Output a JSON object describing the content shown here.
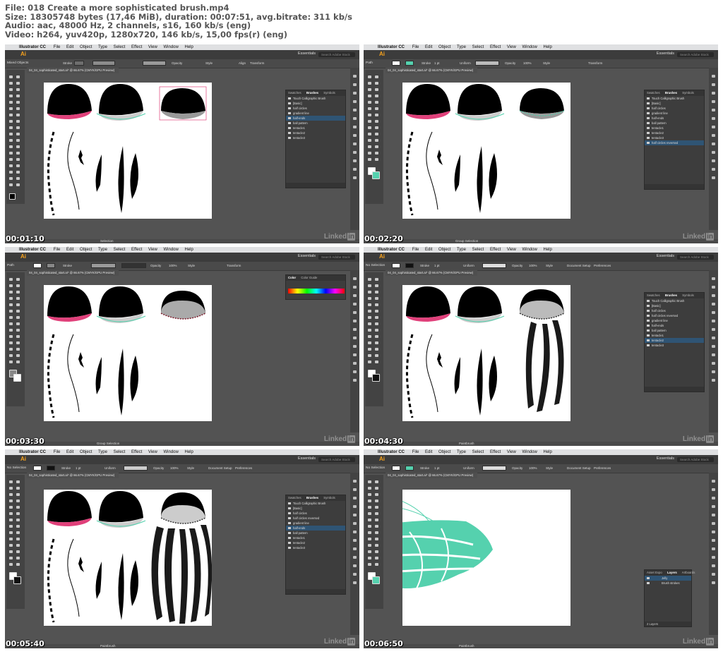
{
  "header": {
    "line1": "File: 018 Create a more sophisticated brush.mp4",
    "line2": "Size: 18305748 bytes (17,46 MiB), duration: 00:07:51, avg.bitrate: 311 kb/s",
    "line3": "Audio: aac, 48000 Hz, 2 channels, s16, 160 kb/s (eng)",
    "line4": "Video: h264, yuv420p, 1280x720, 146 kb/s, 15,00 fps(r) (eng)"
  },
  "ui": {
    "app": "Illustrator CC",
    "menu": [
      "File",
      "Edit",
      "Object",
      "Type",
      "Select",
      "Effect",
      "View",
      "Window",
      "Help"
    ],
    "ai_logo": "Ai",
    "workspace": "Essentials",
    "search_placeholder": "Search Adobe Stock",
    "doc_tab": "04_04_sophisticated_start.ai* @ 66.67% (CMYK/GPU Preview)",
    "watermark_text": "Linked",
    "watermark_in": "in",
    "colors": {
      "accent_teal": "#55d1ae",
      "selection_red": "#e0407a",
      "panel_highlight": "#2f5474"
    }
  },
  "frames": [
    {
      "time": "00:01:10",
      "selection": "Mixed Objects",
      "stroke_label": "Stroke",
      "opacity_label": "Opacity",
      "style_label": "Style",
      "align_label": "Align",
      "transform_label": "Transform",
      "status": "Selection",
      "panel": {
        "tabs": [
          "Swatches",
          "Brushes",
          "Symbols"
        ],
        "rows": [
          "Touch Calligraphic Brush",
          "[Basic]",
          "half circles",
          "gradient line",
          "half-ends",
          "ball pattern",
          "tentacle1",
          "tentacle2",
          "tentacle3"
        ],
        "highlight": 4
      }
    },
    {
      "time": "00:02:20",
      "selection": "Path",
      "stroke_label": "Stroke",
      "stroke_weight": "1 pt",
      "profile": "Uniform",
      "opacity_label": "Opacity",
      "opacity_value": "100%",
      "style_label": "Style",
      "transform_label": "Transform",
      "status": "Group Selection",
      "panel": {
        "tabs": [
          "Swatches",
          "Brushes",
          "Symbols"
        ],
        "rows": [
          "Touch Calligraphic Brush",
          "[Basic]",
          "half circles",
          "gradient line",
          "half-ends",
          "ball pattern",
          "tentacle1",
          "tentacle2",
          "tentacle3",
          "half circles reversed"
        ],
        "highlight": 9
      }
    },
    {
      "time": "00:03:30",
      "selection": "Path",
      "stroke_label": "Stroke",
      "opacity_label": "Opacity",
      "opacity_value": "100%",
      "style_label": "Style",
      "transform_label": "Transform",
      "status": "Group Selection",
      "panel": {
        "tabs": [
          "Color",
          "Color Guide"
        ],
        "rows": [],
        "highlight": -1
      }
    },
    {
      "time": "00:04:30",
      "selection": "No Selection",
      "stroke_label": "Stroke",
      "stroke_weight": "1 pt",
      "profile": "Uniform",
      "opacity_label": "Opacity",
      "opacity_value": "100%",
      "style_label": "Style",
      "doc_setup": "Document Setup",
      "preferences": "Preferences",
      "status": "Paintbrush",
      "panel": {
        "tabs": [
          "Swatches",
          "Brushes",
          "Symbols"
        ],
        "rows": [
          "Touch Calligraphic Brush",
          "[Basic]",
          "half circles",
          "half circles reversed",
          "gradient line",
          "half-ends",
          "ball pattern",
          "tentacle1",
          "tentacle2",
          "tentacle3"
        ],
        "highlight": 8
      }
    },
    {
      "time": "00:05:40",
      "selection": "No Selection",
      "stroke_label": "Stroke",
      "stroke_weight": "1 pt",
      "profile": "Uniform",
      "opacity_label": "Opacity",
      "opacity_value": "100%",
      "style_label": "Style",
      "doc_setup": "Document Setup",
      "preferences": "Preferences",
      "status": "Paintbrush",
      "panel": {
        "tabs": [
          "Swatches",
          "Brushes",
          "Symbols"
        ],
        "rows": [
          "Touch Calligraphic Brush",
          "[Basic]",
          "half circles",
          "half circles reversed",
          "gradient line",
          "half-ends",
          "ball pattern",
          "tentacle1",
          "tentacle2",
          "tentacle3"
        ],
        "highlight": 5
      }
    },
    {
      "time": "00:06:50",
      "selection": "No Selection",
      "stroke_label": "Stroke",
      "stroke_weight": "1 pt",
      "profile": "Uniform",
      "opacity_label": "Opacity",
      "opacity_value": "100%",
      "style_label": "Style",
      "doc_setup": "Document Setup",
      "preferences": "Preferences",
      "status": "Paintbrush",
      "panel": {
        "tabs": [
          "Asset Expo",
          "Layers",
          "Artboards"
        ],
        "rows": [
          "Jelly",
          "Brush strokes"
        ],
        "highlight": 0,
        "footer": "2 Layers"
      }
    }
  ]
}
